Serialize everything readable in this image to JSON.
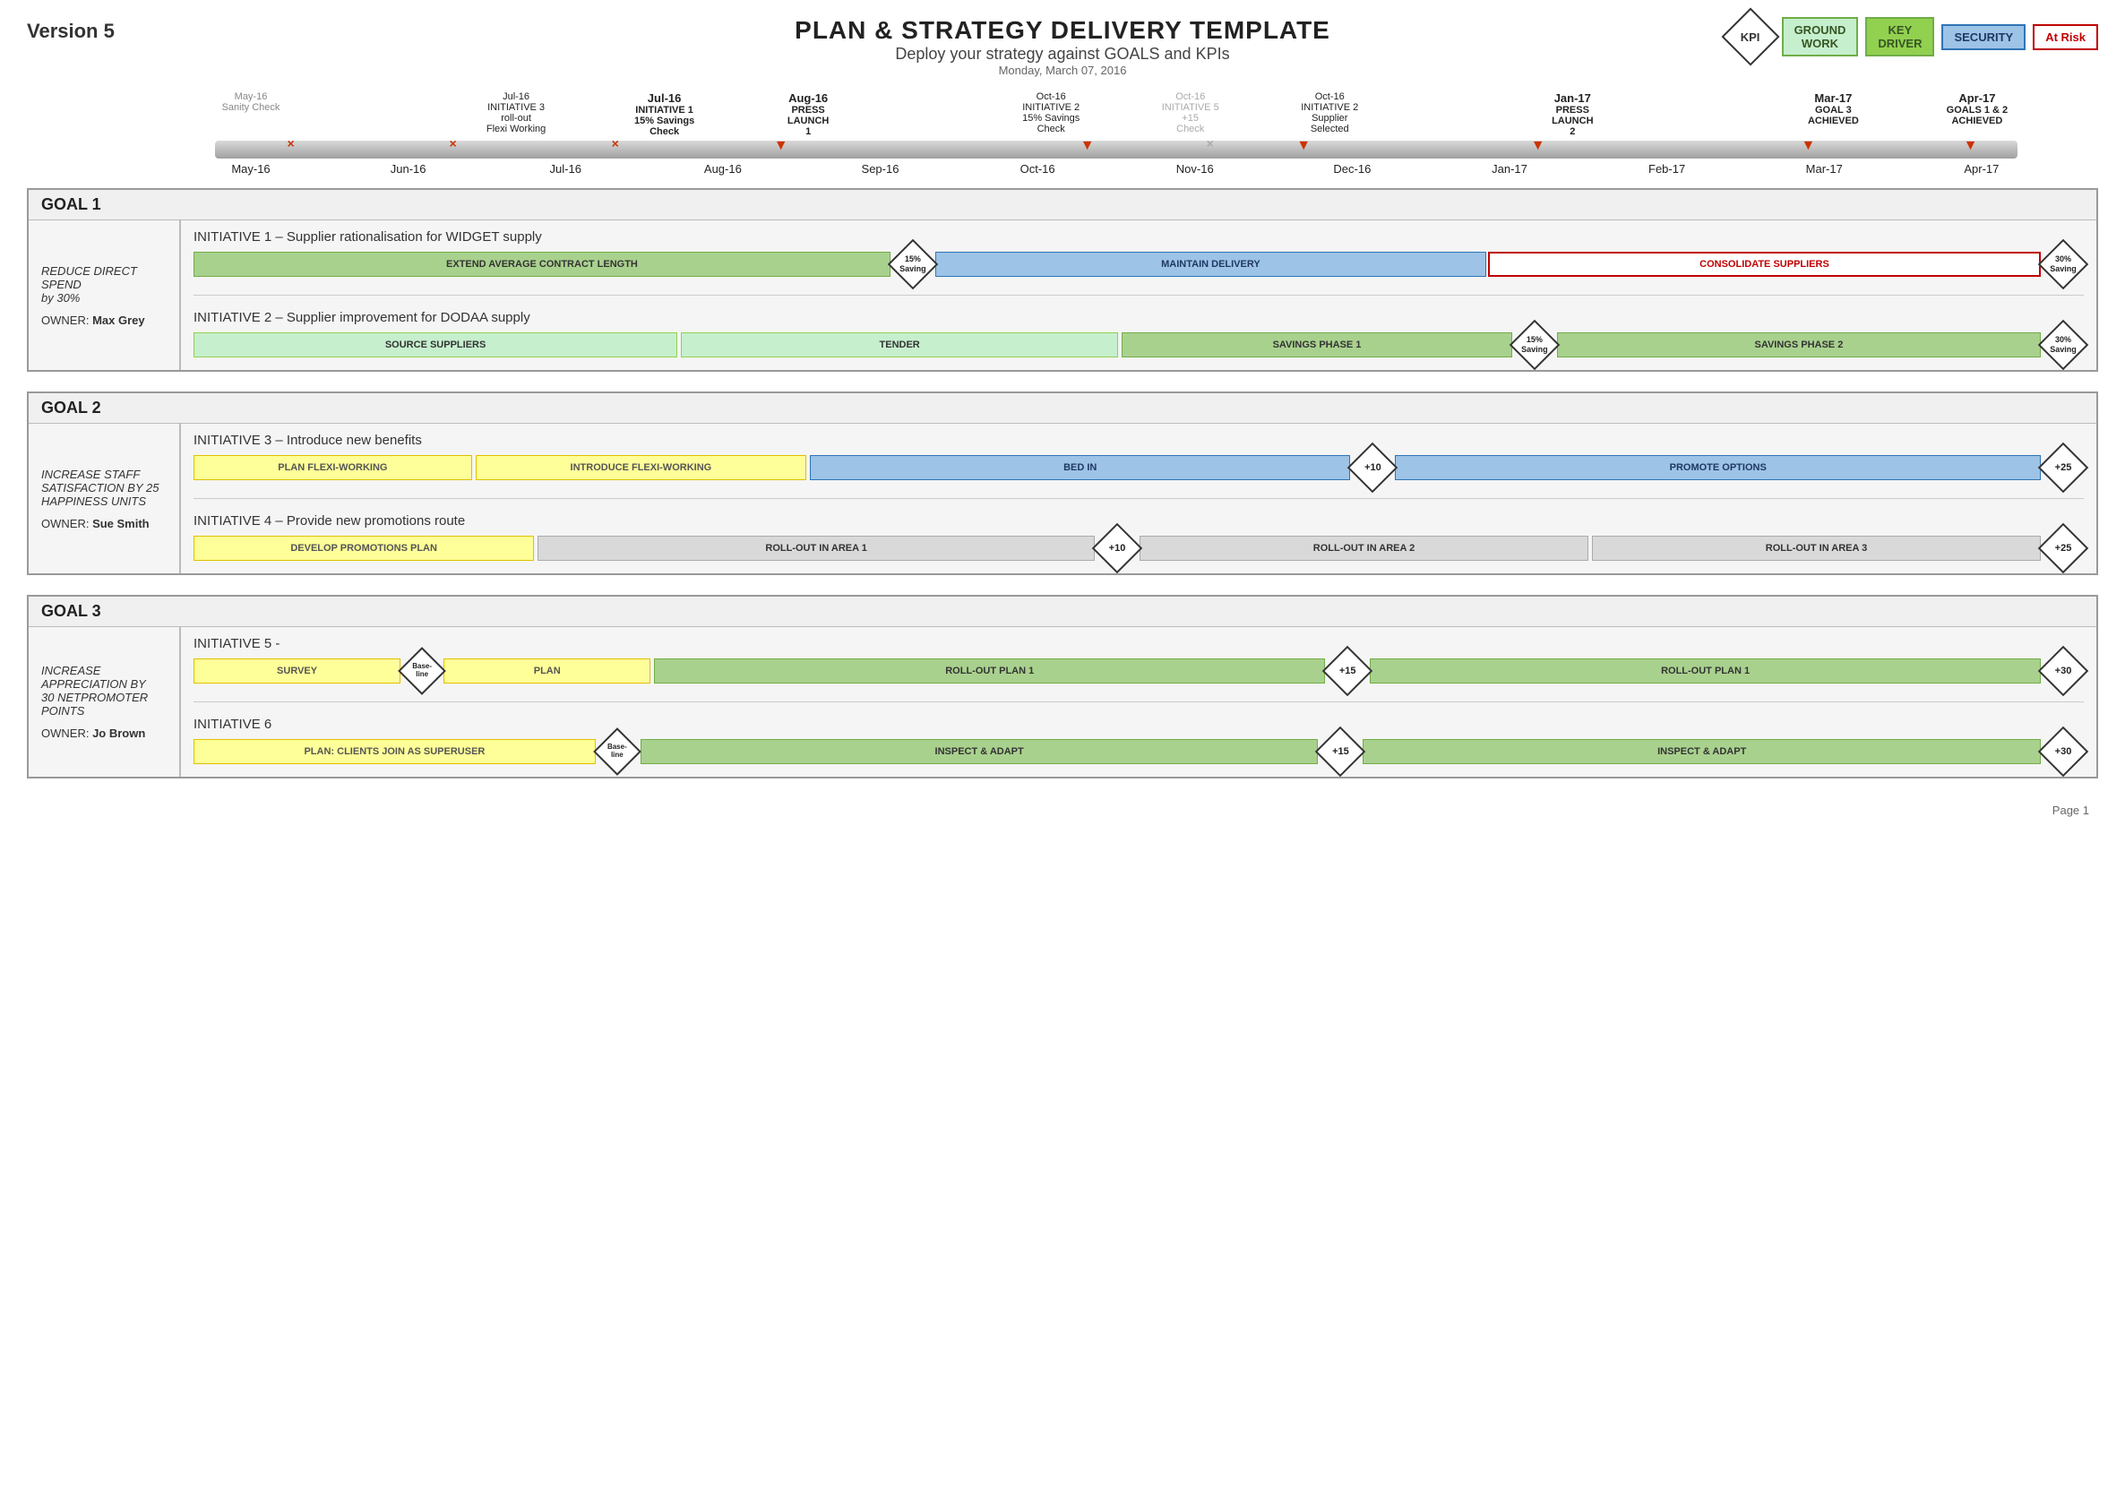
{
  "header": {
    "title": "PLAN & STRATEGY DELIVERY TEMPLATE",
    "subtitle": "Deploy your strategy against GOALS and KPIs",
    "date": "Monday, March 07, 2016",
    "version": "Version 5"
  },
  "legend": {
    "kpi_label": "KPI",
    "groundwork_label": "GROUND\nWORK",
    "key_driver_label": "KEY\nDRIVER",
    "security_label": "SECURITY",
    "at_risk_label": "At Risk"
  },
  "timeline": {
    "months": [
      "May-16",
      "Jun-16",
      "Jul-16",
      "Aug-16",
      "Sep-16",
      "Oct-16",
      "Nov-16",
      "Dec-16",
      "Jan-17",
      "Feb-17",
      "Mar-17",
      "Apr-17"
    ],
    "events": [
      {
        "date": "May-16",
        "lines": [
          "May-16",
          "Sanity Check"
        ],
        "bold": false,
        "gray": false,
        "marker": "none"
      },
      {
        "date": "Jul-16",
        "lines": [
          "Jul-16",
          "INITIATIVE 3",
          "roll-out",
          "Flexi Working"
        ],
        "bold": false,
        "gray": false,
        "marker": "x"
      },
      {
        "date": "Jul-16b",
        "lines": [
          "Jul-16",
          "INITIATIVE 1",
          "15% Savings",
          "Check"
        ],
        "bold": true,
        "gray": false,
        "marker": "x"
      },
      {
        "date": "Aug-16",
        "lines": [
          "Aug-16",
          "PRESS",
          "LAUNCH",
          "1"
        ],
        "bold": true,
        "gray": false,
        "marker": "arrow"
      },
      {
        "date": "Oct-16",
        "lines": [
          "Oct-16",
          "INITIATIVE 2",
          "15% Savings",
          "Check"
        ],
        "bold": false,
        "gray": false,
        "marker": "arrow"
      },
      {
        "date": "Oct-16b",
        "lines": [
          "Oct-16",
          "INITIATIVE 5",
          "+15",
          "Check"
        ],
        "bold": false,
        "gray": true,
        "marker": "x"
      },
      {
        "date": "Oct-16c",
        "lines": [
          "Oct-16",
          "INITIATIVE 2",
          "Supplier",
          "Selected"
        ],
        "bold": false,
        "gray": false,
        "marker": "arrow"
      },
      {
        "date": "Jan-17",
        "lines": [
          "Jan-17",
          "PRESS",
          "LAUNCH",
          "2"
        ],
        "bold": true,
        "gray": false,
        "marker": "arrow"
      },
      {
        "date": "Mar-17",
        "lines": [
          "Mar-17",
          "GOAL 3",
          "ACHIEVED"
        ],
        "bold": true,
        "gray": false,
        "marker": "arrow"
      },
      {
        "date": "Apr-17",
        "lines": [
          "Apr-17",
          "GOALS 1 & 2",
          "ACHIEVED"
        ],
        "bold": true,
        "gray": false,
        "marker": "arrow"
      }
    ]
  },
  "goals": [
    {
      "id": "goal1",
      "header": "GOAL 1",
      "left_text_line1": "REDUCE DIRECT",
      "left_text_line2": "SPEND",
      "left_text_line3": "by 30%",
      "owner_label": "OWNER:",
      "owner_name": "Max Grey",
      "initiatives": [
        {
          "title": "INITIATIVE 1 – Supplier rationalisation for WIDGET supply",
          "bars": [
            {
              "label": "EXTEND AVERAGE CONTRACT LENGTH",
              "type": "green",
              "flex": 28
            },
            {
              "label": "15%\nSaving",
              "type": "diamond",
              "flex": 0
            },
            {
              "label": "MAINTAIN DELIVERY",
              "type": "blue",
              "flex": 22
            },
            {
              "label": "CONSOLIDATE SUPPLIERS",
              "type": "red_outline",
              "flex": 22
            },
            {
              "label": "30%\nSaving",
              "type": "diamond",
              "flex": 0
            }
          ]
        },
        {
          "title": "INITIATIVE 2 – Supplier improvement for DODAA supply",
          "bars": [
            {
              "label": "SOURCE SUPPLIERS",
              "type": "green_light",
              "flex": 20
            },
            {
              "label": "TENDER",
              "type": "green_light",
              "flex": 18
            },
            {
              "label": "SAVINGS PHASE 1",
              "type": "green",
              "flex": 16
            },
            {
              "label": "15%\nSaving",
              "type": "diamond",
              "flex": 0
            },
            {
              "label": "SAVINGS PHASE 2",
              "type": "green",
              "flex": 20
            },
            {
              "label": "30%\nSaving",
              "type": "diamond",
              "flex": 0
            }
          ]
        }
      ]
    },
    {
      "id": "goal2",
      "header": "GOAL 2",
      "left_text_line1": "INCREASE STAFF",
      "left_text_line2": "SATISFACTION BY 25",
      "left_text_line3": "HAPPINESS UNITS",
      "owner_label": "OWNER:",
      "owner_name": "Sue Smith",
      "initiatives": [
        {
          "title": "INITIATIVE 3 – Introduce new benefits",
          "bars": [
            {
              "label": "PLAN FLEXI-WORKING",
              "type": "yellow",
              "flex": 10
            },
            {
              "label": "INTRODUCE FLEXI-WORKING",
              "type": "yellow",
              "flex": 12
            },
            {
              "label": "BED IN",
              "type": "blue",
              "flex": 20
            },
            {
              "label": "+10",
              "type": "diamond",
              "flex": 0
            },
            {
              "label": "PROMOTE OPTIONS",
              "type": "blue",
              "flex": 24
            },
            {
              "label": "+25",
              "type": "diamond",
              "flex": 0
            }
          ]
        },
        {
          "title": "INITIATIVE 4 – Provide new promotions route",
          "bars": [
            {
              "label": "DEVELOP PROMOTIONS PLAN",
              "type": "yellow",
              "flex": 12
            },
            {
              "label": "ROLL-OUT IN AREA 1",
              "type": "gray",
              "flex": 20
            },
            {
              "label": "+10",
              "type": "diamond",
              "flex": 0
            },
            {
              "label": "ROLL-OUT IN AREA 2",
              "type": "gray",
              "flex": 16
            },
            {
              "label": "ROLL-OUT IN AREA 3",
              "type": "gray",
              "flex": 16
            },
            {
              "label": "+25",
              "type": "diamond",
              "flex": 0
            }
          ]
        }
      ]
    },
    {
      "id": "goal3",
      "header": "GOAL 3",
      "left_text_line1": "INCREASE",
      "left_text_line2": "APPRECIATION BY",
      "left_text_line3": "30 NETPROMOTER",
      "left_text_line4": "POINTS",
      "owner_label": "OWNER:",
      "owner_name": "Jo Brown",
      "initiatives": [
        {
          "title": "INITIATIVE 5 -",
          "bars": [
            {
              "label": "SURVEY",
              "type": "yellow",
              "flex": 7
            },
            {
              "label": "Base-\nline",
              "type": "diamond_small",
              "flex": 0
            },
            {
              "label": "PLAN",
              "type": "yellow",
              "flex": 7
            },
            {
              "label": "ROLL-OUT PLAN 1",
              "type": "green",
              "flex": 24
            },
            {
              "label": "+15",
              "type": "diamond",
              "flex": 0
            },
            {
              "label": "ROLL-OUT PLAN 1",
              "type": "green",
              "flex": 24
            },
            {
              "label": "+30",
              "type": "diamond",
              "flex": 0
            }
          ]
        },
        {
          "title": "INITIATIVE 6",
          "bars": [
            {
              "label": "PLAN: CLIENTS JOIN AS SUPERUSER",
              "type": "yellow",
              "flex": 14
            },
            {
              "label": "Base-\nline",
              "type": "diamond_small",
              "flex": 0
            },
            {
              "label": "INSPECT & ADAPT",
              "type": "green",
              "flex": 24
            },
            {
              "label": "+15",
              "type": "diamond",
              "flex": 0
            },
            {
              "label": "INSPECT & ADAPT",
              "type": "green",
              "flex": 24
            },
            {
              "label": "+30",
              "type": "diamond",
              "flex": 0
            }
          ]
        }
      ]
    }
  ],
  "page": {
    "number": "Page 1"
  }
}
